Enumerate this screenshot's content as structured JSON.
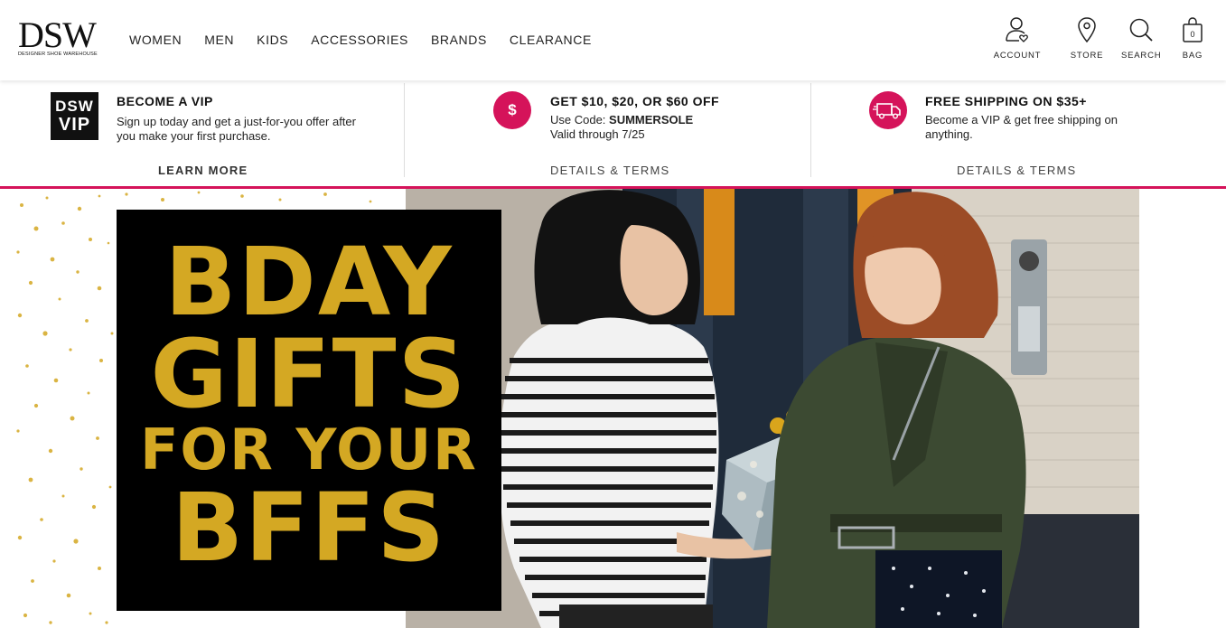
{
  "header": {
    "logo": "DSW",
    "logo_sub": "DESIGNER SHOE WAREHOUSE",
    "nav": [
      "WOMEN",
      "MEN",
      "KIDS",
      "ACCESSORIES",
      "BRANDS",
      "CLEARANCE"
    ],
    "utils": [
      {
        "label": "ACCOUNT",
        "icon": "account-icon"
      },
      {
        "label": "STORE",
        "icon": "store-location-icon"
      },
      {
        "label": "SEARCH",
        "icon": "search-icon"
      },
      {
        "label": "BAG",
        "icon": "bag-icon"
      }
    ],
    "bag_count": "0"
  },
  "promos": {
    "vip": {
      "badge_line1": "DSW",
      "badge_line2": "VIP",
      "title": "BECOME A VIP",
      "text": "Sign up today and get a just-for-you offer after you make your first purchase.",
      "link": "LEARN MORE"
    },
    "offer": {
      "icon_symbol": "$",
      "title": "GET $10, $20, OR $60 OFF",
      "code_prefix": "Use Code: ",
      "code": "SUMMERSOLE",
      "valid": "Valid through 7/25",
      "link": "DETAILS & TERMS"
    },
    "shipping": {
      "title": "FREE SHIPPING ON $35+",
      "text": "Become a VIP & get free shipping on anything.",
      "link": "DETAILS & TERMS"
    }
  },
  "hero": {
    "line1": "BDAY",
    "line2": "GIFTS",
    "line3": "FOR YOUR",
    "line4": "BFFS"
  },
  "colors": {
    "accent": "#d5135a",
    "gold": "#d4a823",
    "black": "#000000"
  }
}
